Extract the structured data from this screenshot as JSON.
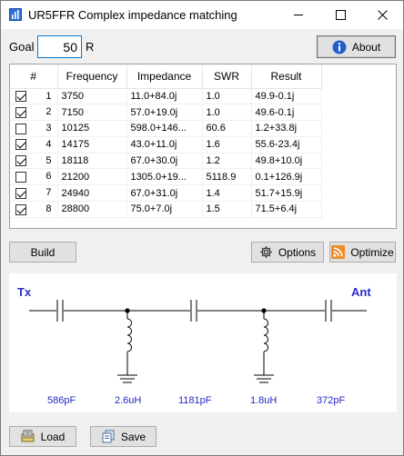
{
  "window": {
    "title": "UR5FFR Complex impedance matching",
    "controls": {
      "minimize": "minimize",
      "maximize": "maximize",
      "close": "close"
    }
  },
  "goal": {
    "label": "Goal",
    "value": "50",
    "unit": "R"
  },
  "about_button": {
    "label": "About",
    "icon": "info-icon"
  },
  "table": {
    "columns": [
      "#",
      "Frequency",
      "Impedance",
      "SWR",
      "Result"
    ],
    "rows": [
      {
        "checked": true,
        "num": "1",
        "frequency": "3750",
        "impedance": "11.0+84.0j",
        "swr": "1.0",
        "result": "49.9-0.1j"
      },
      {
        "checked": true,
        "num": "2",
        "frequency": "7150",
        "impedance": "57.0+19.0j",
        "swr": "1.0",
        "result": "49.6-0.1j"
      },
      {
        "checked": false,
        "num": "3",
        "frequency": "10125",
        "impedance": "598.0+146...",
        "swr": "60.6",
        "result": "1.2+33.8j"
      },
      {
        "checked": true,
        "num": "4",
        "frequency": "14175",
        "impedance": "43.0+11.0j",
        "swr": "1.6",
        "result": "55.6-23.4j"
      },
      {
        "checked": true,
        "num": "5",
        "frequency": "18118",
        "impedance": "67.0+30.0j",
        "swr": "1.2",
        "result": "49.8+10.0j"
      },
      {
        "checked": false,
        "num": "6",
        "frequency": "21200",
        "impedance": "1305.0+19...",
        "swr": "5118.9",
        "result": "0.1+126.9j"
      },
      {
        "checked": true,
        "num": "7",
        "frequency": "24940",
        "impedance": "67.0+31.0j",
        "swr": "1.4",
        "result": "51.7+15.9j"
      },
      {
        "checked": true,
        "num": "8",
        "frequency": "28800",
        "impedance": "75.0+7.0j",
        "swr": "1.5",
        "result": "71.5+6.4j"
      }
    ]
  },
  "buttons": {
    "build": "Build",
    "options": "Options",
    "optimize": "Optimize",
    "load": "Load",
    "save": "Save"
  },
  "schematic": {
    "tx_label": "Tx",
    "ant_label": "Ant",
    "components": [
      "586pF",
      "2.6uH",
      "1181pF",
      "1.8uH",
      "372pF"
    ]
  },
  "colors": {
    "accent": "#0078d7",
    "schematic_text": "#2626c4",
    "optimize_icon": "#f08a24"
  }
}
